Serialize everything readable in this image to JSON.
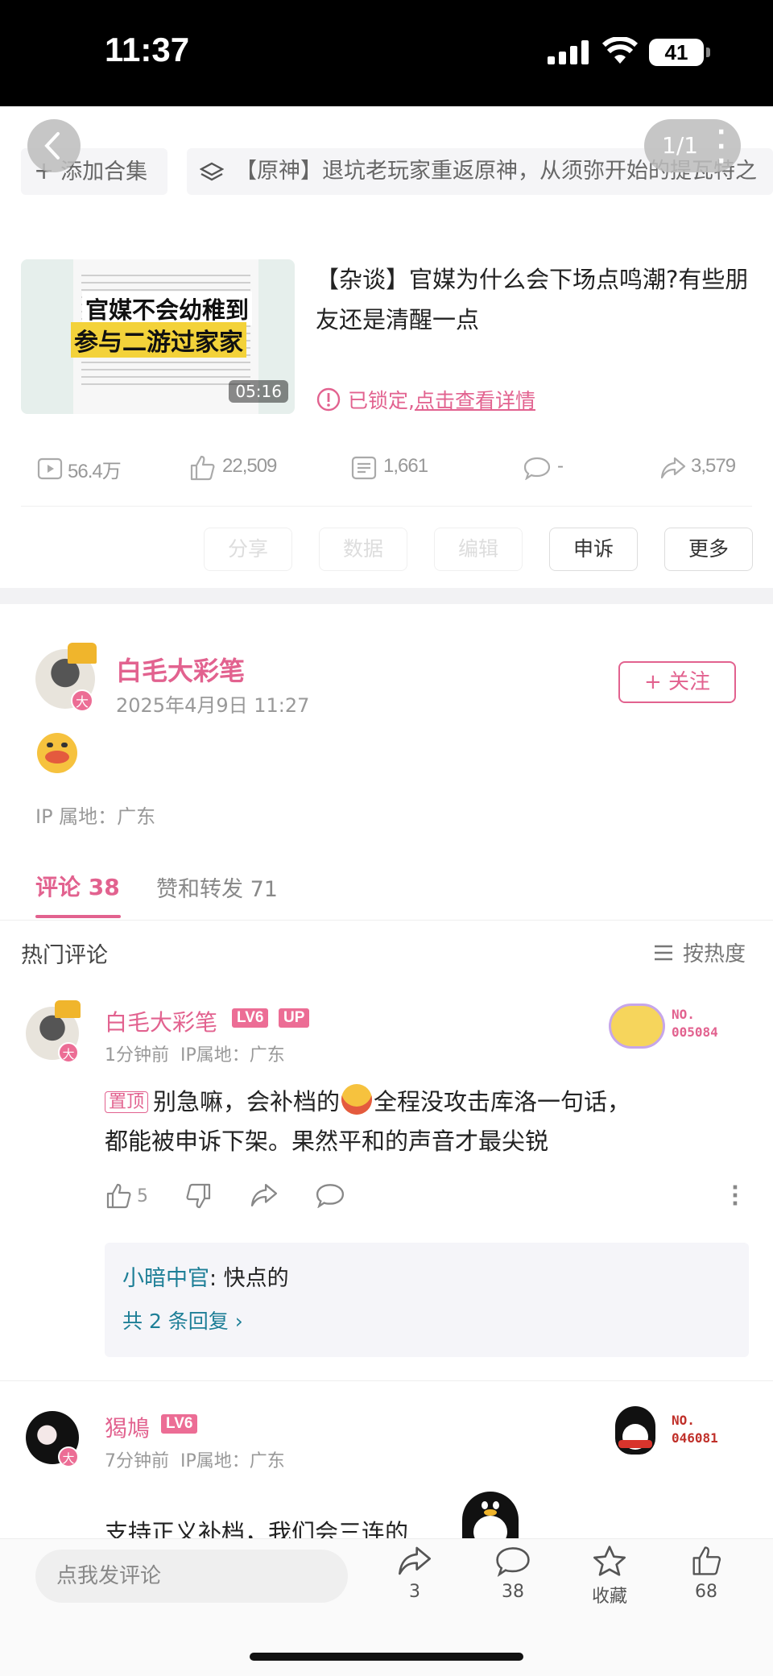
{
  "status": {
    "time": "11:37",
    "battery": "41"
  },
  "nav": {
    "page_indicator": "1/1"
  },
  "collection": {
    "add_label": "添加合集",
    "series_title": "【原神】退坑老玩家重返原神，从须弥开始的提瓦特之"
  },
  "video": {
    "thumb_caption_1": "官媒不会幼稚到",
    "thumb_caption_2": "参与二游过家家",
    "duration": "05:16",
    "title": "【杂谈】官媒为什么会下场点鸣潮?有些朋友还是清醒一点",
    "locked_prefix": "已锁定,",
    "locked_link": "点击查看详情",
    "stats": {
      "views": "56.4万",
      "likes": "22,509",
      "danmaku": "1,661",
      "comments": "-",
      "shares": "3,579"
    },
    "buttons": {
      "share": "分享",
      "data": "数据",
      "edit": "编辑",
      "appeal": "申诉",
      "more": "更多"
    }
  },
  "post": {
    "author": "白毛大彩笔",
    "date": "2025年4月9日 11:27",
    "follow": "+ 关注",
    "ip": "IP 属地：广东",
    "avatar_badge": "大"
  },
  "tabs": {
    "comments": "评论 38",
    "likes_reposts": "赞和转发 71"
  },
  "comments_header": {
    "title": "热门评论",
    "sort": "按热度"
  },
  "comments": [
    {
      "user": "白毛大彩笔",
      "level": "LV6",
      "up_badge": "UP",
      "meta": "1分钟前  IP属地：广东",
      "pinned": "置顶",
      "text_1": "别急嘛，会补档的",
      "text_2": "全程没攻击库洛一句话，",
      "text_3": "都能被申诉下架。果然平和的声音才最尖锐",
      "likes": "5",
      "no_label": "NO.",
      "no_value": "005084",
      "reply_user": "小暗中官",
      "reply_text": ": 快点的",
      "reply_more": "共 2 条回复 ›"
    },
    {
      "user": "猲鳩",
      "level": "LV6",
      "meta": "7分钟前  IP属地：广东",
      "text_1": "支持正义补档，我们会三连的",
      "no_label": "NO.",
      "no_value": "046081"
    }
  ],
  "bottom": {
    "input_placeholder": "点我发评论",
    "share_count": "3",
    "comment_count": "38",
    "favorite_label": "收藏",
    "like_count": "68"
  }
}
